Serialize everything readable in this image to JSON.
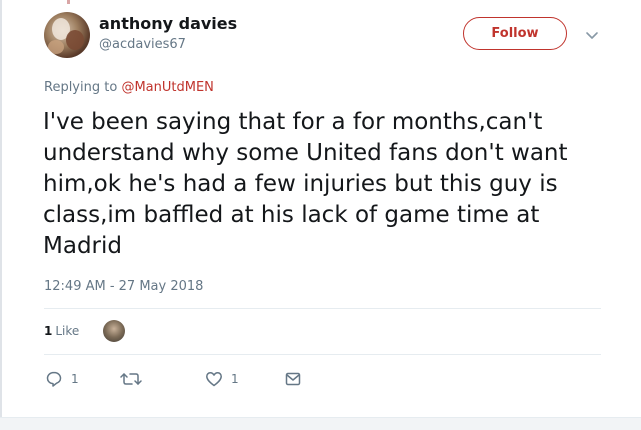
{
  "tweet": {
    "display_name": "anthony davies",
    "handle": "@acdavies67",
    "follow_label": "Follow",
    "replying_prefix": "Replying to ",
    "replying_to": "@ManUtdMEN",
    "text_lines": [
      "I've been saying that for a for months,can't",
      "understand why some United fans don't want",
      "him,ok he's had a few injuries but this guy is",
      "class,im baffled at his lack of game time at",
      "Madrid"
    ],
    "timestamp": "12:49 AM - 27 May 2018",
    "likes_count": "1",
    "likes_label": "Like"
  },
  "actions": {
    "reply_count": "1",
    "retweet_count": "",
    "like_count": "1"
  },
  "icons": {
    "reply": "reply-icon",
    "retweet": "retweet-icon",
    "like": "heart-icon",
    "dm": "envelope-icon",
    "more": "chevron-down-icon"
  },
  "colors": {
    "accent": "#c0342d",
    "text": "#14171a",
    "muted": "#657786"
  }
}
